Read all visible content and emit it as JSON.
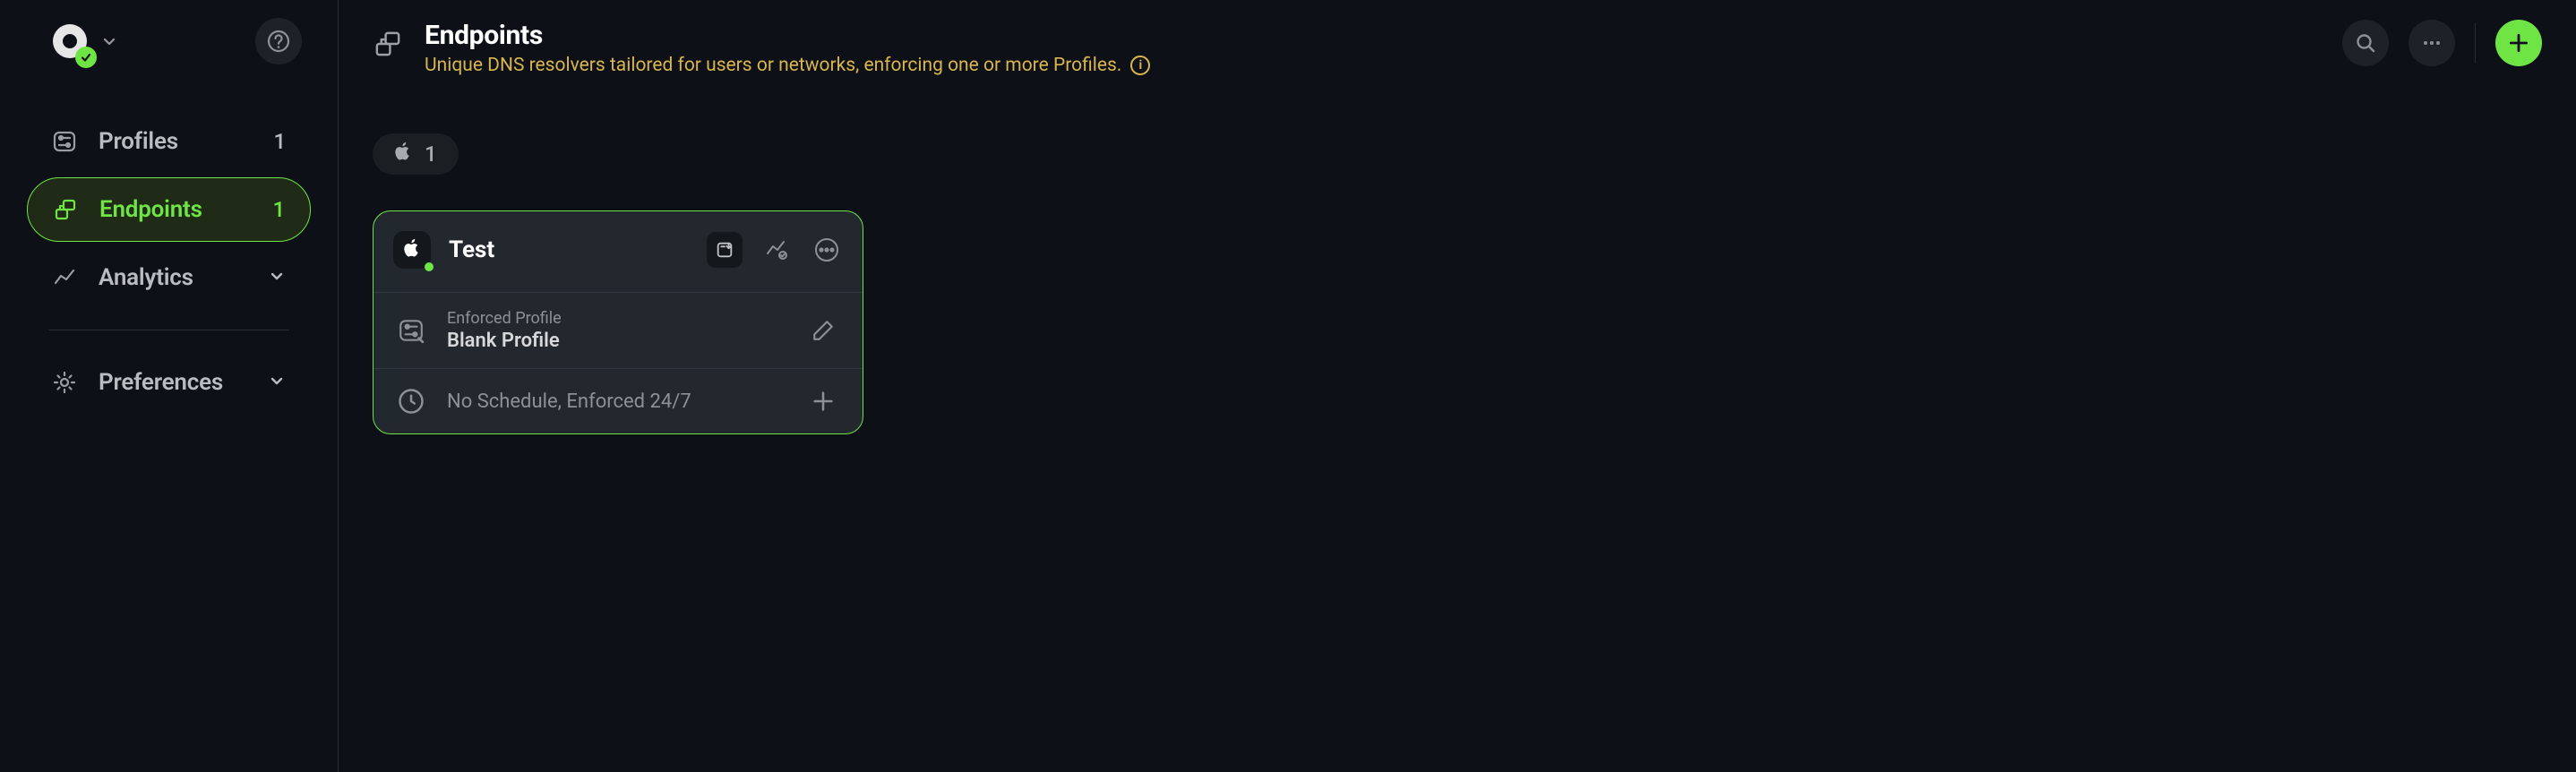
{
  "sidebar": {
    "items": [
      {
        "label": "Profiles",
        "count": "1"
      },
      {
        "label": "Endpoints",
        "count": "1"
      },
      {
        "label": "Analytics"
      },
      {
        "label": "Preferences"
      }
    ]
  },
  "header": {
    "title": "Endpoints",
    "subtitle": "Unique DNS resolvers tailored for users or networks, enforcing one or more Profiles.",
    "info_icon_glyph": "i"
  },
  "filters": {
    "apple_count": "1"
  },
  "card": {
    "title": "Test",
    "profile_label": "Enforced Profile",
    "profile_value": "Blank Profile",
    "schedule": "No Schedule, Enforced 24/7"
  },
  "colors": {
    "accent": "#6ee545",
    "warn": "#d9b54f"
  }
}
